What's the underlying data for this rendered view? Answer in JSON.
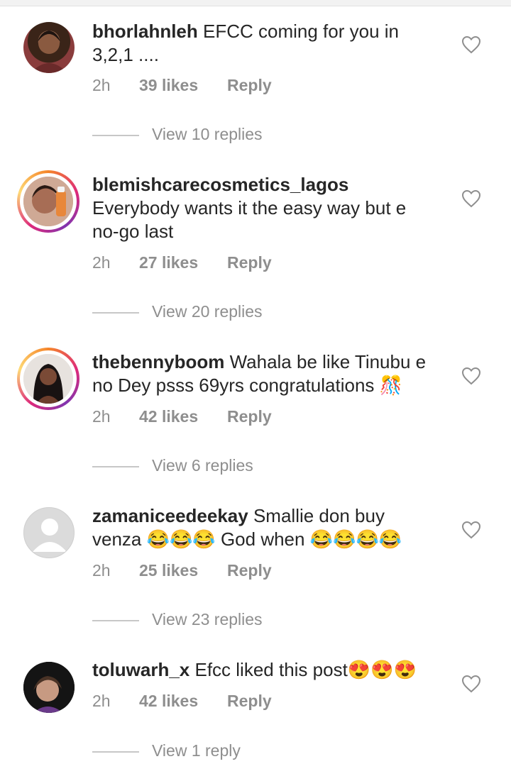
{
  "comments": [
    {
      "username": "bhorlahnleh",
      "text": "EFCC coming for you in 3,2,1 ....",
      "time": "2h",
      "likes": "39 likes",
      "reply": "Reply",
      "view_replies": "View 10 replies",
      "story_ring": false,
      "avatar": "photo-woman"
    },
    {
      "username": "blemishcarecosmetics_lagos",
      "text": "Everybody wants it the easy way but e no-go last",
      "time": "2h",
      "likes": "27 likes",
      "reply": "Reply",
      "view_replies": "View 20 replies",
      "story_ring": true,
      "avatar": "photo-product"
    },
    {
      "username": "thebennyboom",
      "text": "Wahala be like Tinubu e no Dey psss 69yrs congratulations 🎊",
      "time": "2h",
      "likes": "42 likes",
      "reply": "Reply",
      "view_replies": "View 6 replies",
      "story_ring": true,
      "avatar": "photo-woman-dark"
    },
    {
      "username": "zamaniceedeekay",
      "text": "Smallie don buy venza 😂😂😂 God when 😂😂😂😂",
      "time": "2h",
      "likes": "25 likes",
      "reply": "Reply",
      "view_replies": "View 23 replies",
      "story_ring": false,
      "avatar": "default-avatar"
    },
    {
      "username": "toluwarh_x",
      "text": "Efcc liked this post😍😍😍",
      "time": "2h",
      "likes": "42 likes",
      "reply": "Reply",
      "view_replies": "View 1 reply",
      "story_ring": false,
      "avatar": "photo-child"
    }
  ],
  "colors": {
    "text": "#262626",
    "secondary": "#8e8e8e",
    "ring_start": "#f58529",
    "ring_end": "#dd2a7b"
  },
  "icons": {
    "like": "heart-outline-icon"
  }
}
